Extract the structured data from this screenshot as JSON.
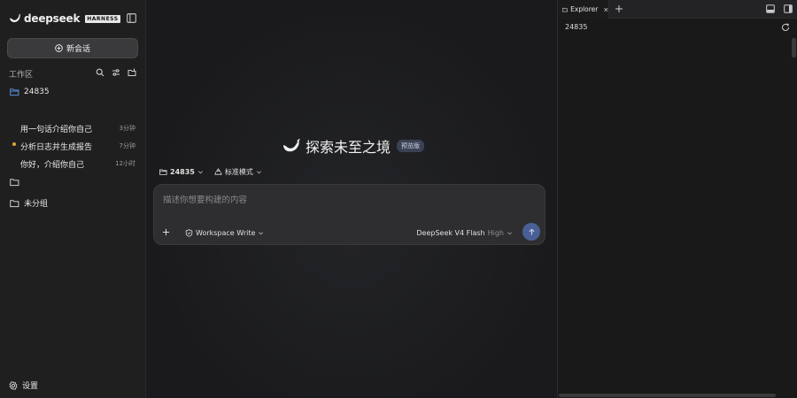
{
  "sidebar": {
    "brand": "deepseek",
    "brand_tag": "HARNESS",
    "new_chat_label": "新会话",
    "workspace_label": "工作区",
    "workspace_folder": "24835",
    "chats": [
      {
        "title": "用一句话介绍你自己",
        "time": "3分钟",
        "active": false
      },
      {
        "title": "分析日志并生成报告",
        "time": "7分钟",
        "active": true
      },
      {
        "title": "你好，介绍你自己",
        "time": "12小时",
        "active": false
      }
    ],
    "empty_group_label": "",
    "ungrouped_label": "未分组",
    "settings_label": "设置"
  },
  "main": {
    "hero_title": "探索未至之境",
    "hero_badge": "预览版",
    "context": {
      "folder": "24835",
      "mode": "标准模式"
    },
    "composer": {
      "placeholder": "描述你想要构建的内容",
      "permission": "Workspace Write",
      "model": "DeepSeek V4 Flash",
      "level": "High"
    }
  },
  "explorer": {
    "tab_label": "Explorer",
    "path": "24835"
  },
  "colors": {
    "accent": "#4a5f96",
    "active_dot": "#e0a43a",
    "folder_blue": "#5b8dd6"
  }
}
